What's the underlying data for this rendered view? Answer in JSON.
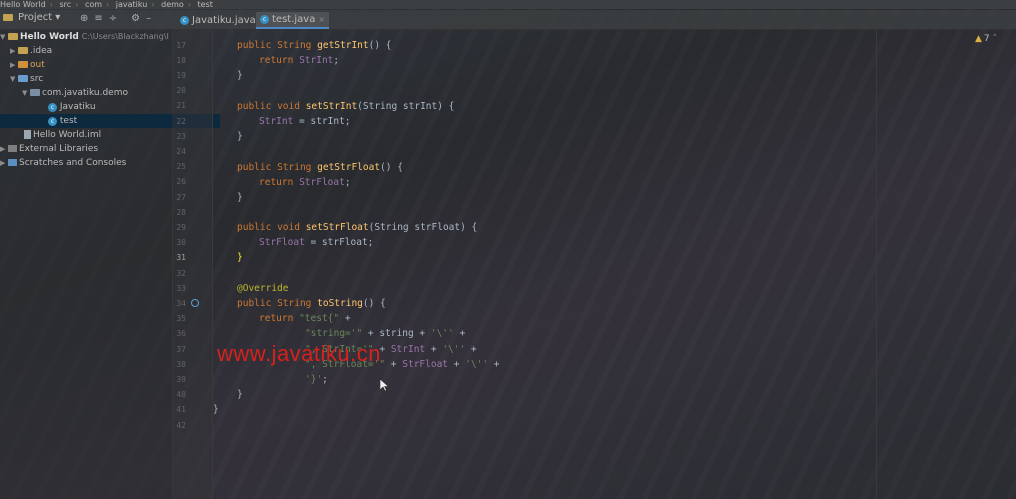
{
  "breadcrumb": [
    "Hello World",
    "src",
    "com",
    "javatiku",
    "demo",
    "test"
  ],
  "project_label": "Project",
  "tabs": [
    {
      "label": "Javatiku.java",
      "active": false
    },
    {
      "label": "test.java",
      "active": true
    }
  ],
  "tree": [
    {
      "name": "Hello World",
      "extra": "C:\\Users\\Blackzhang\\I",
      "icon": "folder"
    },
    {
      "name": ".idea",
      "icon": "folder"
    },
    {
      "name": "out",
      "icon": "folder-out"
    },
    {
      "name": "src",
      "icon": "folder-src"
    },
    {
      "name": "com.javatiku.demo",
      "icon": "package"
    },
    {
      "name": "Javatiku",
      "icon": "class"
    },
    {
      "name": "test",
      "icon": "class",
      "selected": true
    },
    {
      "name": "Hello World.iml",
      "icon": "file"
    },
    {
      "name": "External Libraries",
      "icon": "library"
    },
    {
      "name": "Scratches and Consoles",
      "icon": "scratches"
    }
  ],
  "warnings": {
    "count": "7"
  },
  "line_numbers": [
    "17",
    "18",
    "19",
    "20",
    "21",
    "22",
    "23",
    "24",
    "25",
    "26",
    "27",
    "28",
    "29",
    "30",
    "31",
    "32",
    "33",
    "34",
    "35",
    "36",
    "37",
    "38",
    "39",
    "40",
    "41",
    "42"
  ],
  "current_line": "31",
  "code": {
    "l17a": "public",
    "l17b": "String",
    "l17c": "getStrInt",
    "l17d": "() {",
    "l18a": "return",
    "l18b": "StrInt",
    "l18c": ";",
    "l19": "}",
    "l21a": "public",
    "l21b": "void",
    "l21c": "setStrInt",
    "l21d": "(String strInt) {",
    "l22a": "StrInt",
    "l22b": " = strInt;",
    "l23": "}",
    "l25a": "public",
    "l25b": "String",
    "l25c": "getStrFloat",
    "l25d": "() {",
    "l26a": "return",
    "l26b": "StrFloat",
    "l26c": ";",
    "l27": "}",
    "l29a": "public",
    "l29b": "void",
    "l29c": "setStrFloat",
    "l29d": "(String strFloat) {",
    "l30a": "StrFloat",
    "l30b": " = strFloat;",
    "l31": "}",
    "l33": "@Override",
    "l34a": "public",
    "l34b": "String",
    "l34c": "toString",
    "l34d": "() {",
    "l35a": "return",
    "l35b": "\"test{\"",
    "l35c": " +",
    "l36a": "\"string='\"",
    "l36b": " + string + ",
    "l36c": "'\\''",
    "l36d": " +",
    "l37a": "\", StrInt='\"",
    "l37b": " + ",
    "l37c": "StrInt",
    "l37d": " + ",
    "l37e": "'\\''",
    "l37f": " +",
    "l38a": "\", StrFloat='\"",
    "l38b": " + ",
    "l38c": "StrFloat",
    "l38d": " + ",
    "l38e": "'\\''",
    "l38f": " +",
    "l39a": "'}'",
    "l39b": ";",
    "l40": "}",
    "l41": "}"
  },
  "watermark": "www.javatiku.cn"
}
